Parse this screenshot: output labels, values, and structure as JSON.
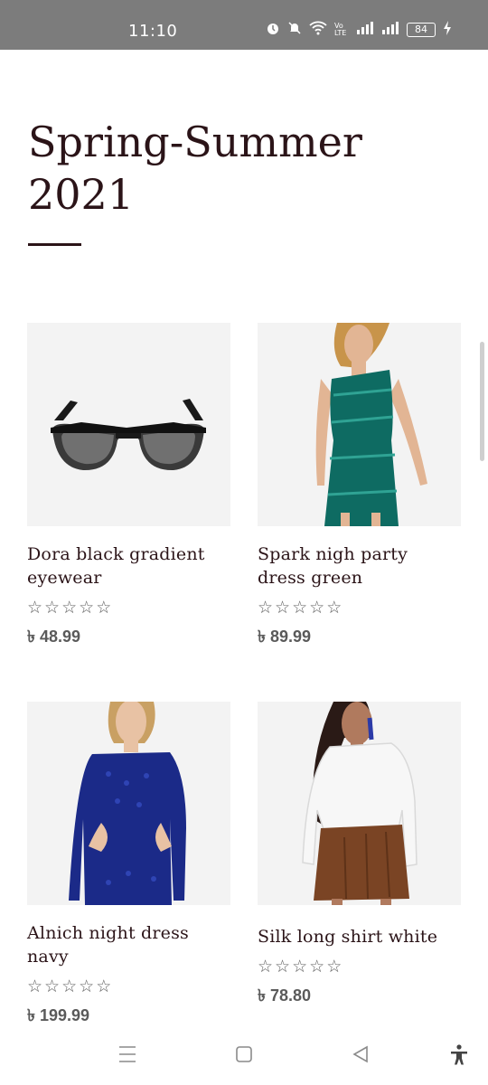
{
  "status_bar": {
    "time": "11:10",
    "icons": [
      "alarm-icon",
      "mute-icon",
      "wifi-icon",
      "volte-icon",
      "signal-icon",
      "signal-icon",
      "battery-icon",
      "charging-icon"
    ],
    "volte_label": "Vo LTE",
    "battery_level": "84"
  },
  "page": {
    "title_line1": "Spring-Summer",
    "title_line2": "2021"
  },
  "products": [
    {
      "name": "Dora black gradient eyewear",
      "price": "৳ 48.99",
      "rating": 0,
      "image": "sunglasses"
    },
    {
      "name": "Spark nigh party dress green",
      "price": "৳ 89.99",
      "rating": 0,
      "image": "green-dress"
    },
    {
      "name": "Alnich night dress navy",
      "price": "৳ 199.99",
      "rating": 0,
      "image": "navy-dress"
    },
    {
      "name": "Silk long shirt white",
      "price": "৳ 78.80",
      "rating": 0,
      "image": "white-shirt"
    }
  ],
  "nav_bar": {
    "icons": [
      "menu-icon",
      "home-square-icon",
      "back-icon",
      "accessibility-icon"
    ]
  },
  "colors": {
    "status_bar": "#7c7c7c",
    "title": "#2b1418",
    "image_bg": "#f3f3f3",
    "price": "#5a5a5a"
  }
}
